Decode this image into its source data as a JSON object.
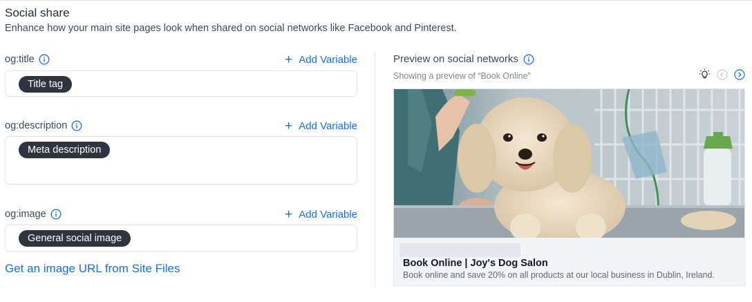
{
  "header": {
    "title": "Social share",
    "subtitle": "Enhance how your main site pages look when shared on social networks like Facebook and Pinterest."
  },
  "fields": [
    {
      "label": "og:title",
      "add_variable": "Add Variable",
      "chip": "Title tag"
    },
    {
      "label": "og:description",
      "add_variable": "Add Variable",
      "chip": "Meta description"
    },
    {
      "label": "og:image",
      "add_variable": "Add Variable",
      "chip": "General social image"
    }
  ],
  "site_files_link": "Get an image URL from Site Files",
  "preview": {
    "title": "Preview on social networks",
    "subtitle": "Showing a preview of “Book Online”",
    "card_title": "Book Online | Joy's Dog Salon",
    "card_description": "Book online and save 20% on all products at our local business in Dublin, Ireland."
  },
  "icons": {
    "info": "info-icon",
    "plus": "plus-icon",
    "tip": "lightbulb-icon",
    "prev": "chevron-left-icon",
    "next": "chevron-right-icon"
  },
  "colors": {
    "accent": "#116dff",
    "chip_bg": "#2f3441",
    "text": "#20303c",
    "border": "#dfe5eb"
  }
}
